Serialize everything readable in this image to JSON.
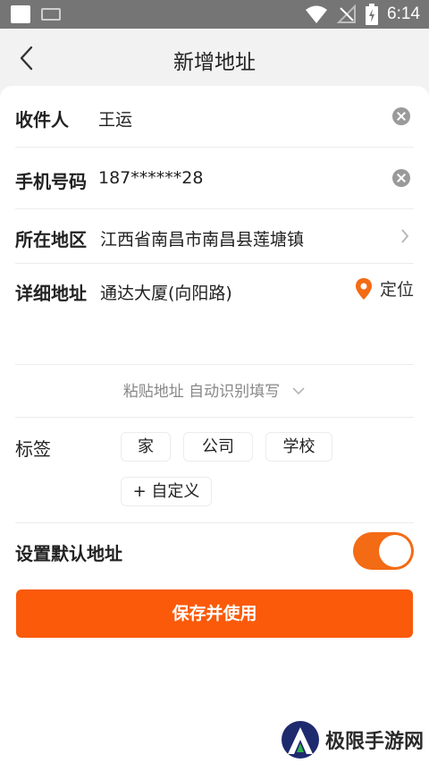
{
  "status_bar": {
    "time": "6:14",
    "icons": [
      "app-square-icon",
      "keyboard-icon",
      "wifi-icon",
      "no-signal-icon",
      "battery-charging-icon"
    ]
  },
  "nav": {
    "title": "新增地址",
    "back_icon": "chevron-left-icon"
  },
  "form": {
    "recipient": {
      "label": "收件人",
      "value": "王运"
    },
    "phone": {
      "label": "手机号码",
      "value": "187******28"
    },
    "region": {
      "label": "所在地区",
      "value": "江西省南昌市南昌县莲塘镇"
    },
    "detail": {
      "label": "详细地址",
      "value": "通达大厦(向阳路)",
      "locate_label": "定位"
    },
    "paste": {
      "label": "粘贴地址 自动识别填写"
    },
    "tags": {
      "label": "标签",
      "items": [
        "家",
        "公司",
        "学校",
        "+ 自定义"
      ]
    },
    "default": {
      "label": "设置默认地址",
      "on": true
    }
  },
  "actions": {
    "save_label": "保存并使用"
  },
  "watermark": {
    "text": "极限手游网"
  },
  "colors": {
    "accent": "#fa5a0a",
    "toggle": "#f36b15",
    "status_bar": "#757575"
  }
}
